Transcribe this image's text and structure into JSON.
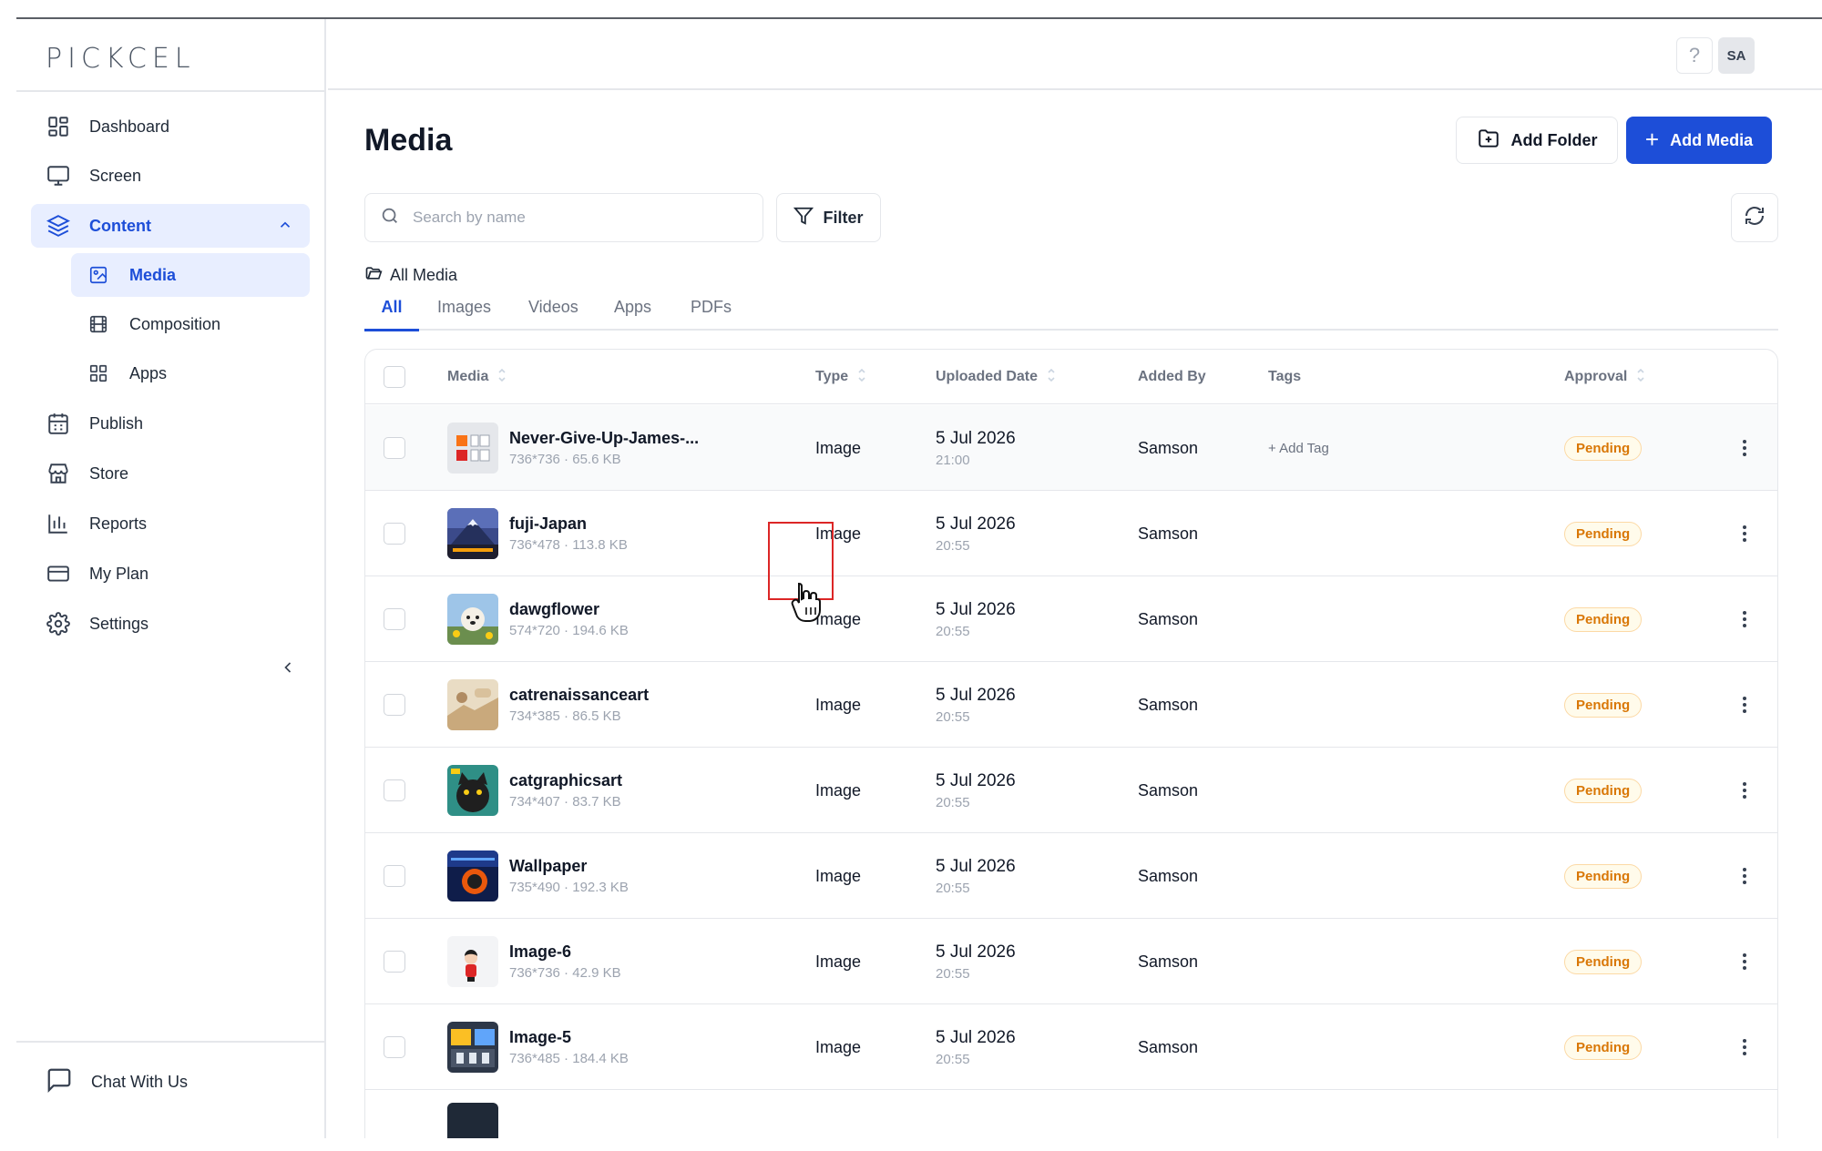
{
  "app": {
    "logo": "PICKCEL"
  },
  "sidebar": {
    "items": [
      {
        "label": "Dashboard",
        "icon": "dashboard-icon"
      },
      {
        "label": "Screen",
        "icon": "monitor-icon"
      },
      {
        "label": "Content",
        "icon": "layers-icon",
        "expanded": true
      },
      {
        "label": "Media",
        "icon": "media-icon",
        "active": true
      },
      {
        "label": "Composition",
        "icon": "film-icon"
      },
      {
        "label": "Apps",
        "icon": "grid-icon"
      },
      {
        "label": "Publish",
        "icon": "calendar-icon"
      },
      {
        "label": "Store",
        "icon": "store-icon"
      },
      {
        "label": "Reports",
        "icon": "bar-chart-icon"
      },
      {
        "label": "My Plan",
        "icon": "credit-card-icon"
      },
      {
        "label": "Settings",
        "icon": "gear-icon"
      }
    ],
    "chat_label": "Chat With Us"
  },
  "header": {
    "help": "?",
    "avatar": "SA"
  },
  "main": {
    "title": "Media",
    "add_folder": "Add Folder",
    "add_media": "Add Media",
    "search_placeholder": "Search by name",
    "filter": "Filter",
    "breadcrumb": "All Media",
    "tabs": [
      "All",
      "Images",
      "Videos",
      "Apps",
      "PDFs"
    ],
    "active_tab": "All"
  },
  "table": {
    "columns": [
      "Media",
      "Type",
      "Uploaded Date",
      "Added By",
      "Tags",
      "Approval"
    ],
    "rows": [
      {
        "name": "Never-Give-Up-James-...",
        "meta": "736*736 · 65.6 KB",
        "type": "Image",
        "date": "5 Jul 2026",
        "time": "21:00",
        "added_by": "Samson",
        "tags": "+ Add Tag",
        "approval": "Pending"
      },
      {
        "name": "fuji-Japan",
        "meta": "736*478 · 113.8 KB",
        "type": "Image",
        "date": "5 Jul 2026",
        "time": "20:55",
        "added_by": "Samson",
        "tags": "",
        "approval": "Pending"
      },
      {
        "name": "dawgflower",
        "meta": "574*720 · 194.6 KB",
        "type": "Image",
        "date": "5 Jul 2026",
        "time": "20:55",
        "added_by": "Samson",
        "tags": "",
        "approval": "Pending"
      },
      {
        "name": "catrenaissanceart",
        "meta": "734*385 · 86.5 KB",
        "type": "Image",
        "date": "5 Jul 2026",
        "time": "20:55",
        "added_by": "Samson",
        "tags": "",
        "approval": "Pending"
      },
      {
        "name": "catgraphicsart",
        "meta": "734*407 · 83.7 KB",
        "type": "Image",
        "date": "5 Jul 2026",
        "time": "20:55",
        "added_by": "Samson",
        "tags": "",
        "approval": "Pending"
      },
      {
        "name": "Wallpaper",
        "meta": "735*490 · 192.3 KB",
        "type": "Image",
        "date": "5 Jul 2026",
        "time": "20:55",
        "added_by": "Samson",
        "tags": "",
        "approval": "Pending"
      },
      {
        "name": "Image-6",
        "meta": "736*736 · 42.9 KB",
        "type": "Image",
        "date": "5 Jul 2026",
        "time": "20:55",
        "added_by": "Samson",
        "tags": "",
        "approval": "Pending"
      },
      {
        "name": "Image-5",
        "meta": "736*485 · 184.4 KB",
        "type": "Image",
        "date": "5 Jul 2026",
        "time": "20:55",
        "added_by": "Samson",
        "tags": "",
        "approval": "Pending"
      }
    ]
  },
  "colors": {
    "accent": "#1d4ed8",
    "active_bg": "#e8eeff",
    "pending": "#d97706"
  }
}
